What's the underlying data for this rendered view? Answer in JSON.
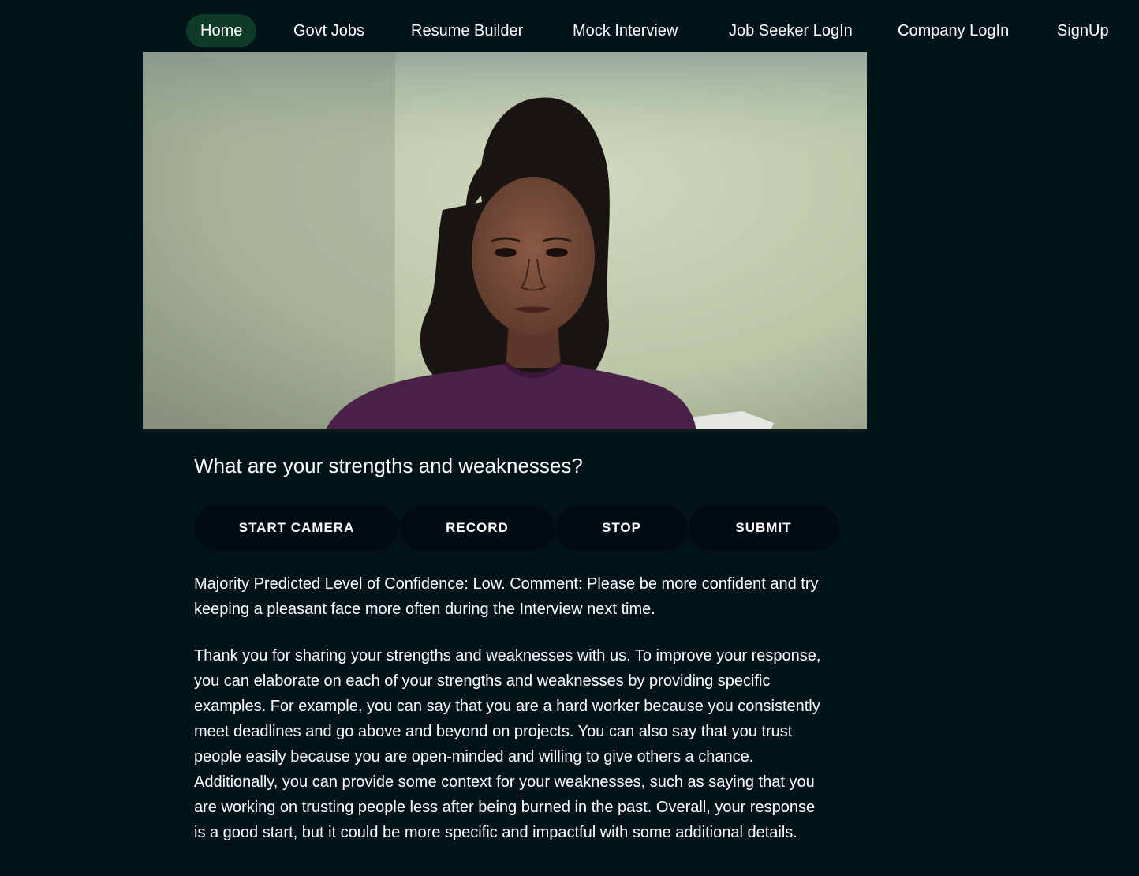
{
  "nav": {
    "items": [
      {
        "label": "Home",
        "active": true
      },
      {
        "label": "Govt Jobs"
      },
      {
        "label": "Resume Builder"
      },
      {
        "label": "Mock Interview"
      },
      {
        "label": "Job Seeker LogIn"
      },
      {
        "label": "Company LogIn"
      },
      {
        "label": "SignUp"
      }
    ]
  },
  "question": "What are your strengths and weaknesses?",
  "buttons": {
    "start_camera": "START CAMERA",
    "record": "RECORD",
    "stop": "STOP",
    "submit": "SUBMIT"
  },
  "feedback": {
    "confidence": "Majority Predicted Level of Confidence: Low. Comment: Please be more confident and try keeping a pleasant face more often during the Interview next time.",
    "response": "Thank you for sharing your strengths and weaknesses with us. To improve your response, you can elaborate on each of your strengths and weaknesses by providing specific examples. For example, you can say that you are a hard worker because you consistently meet deadlines and go above and beyond on projects. You can also say that you trust people easily because you are open-minded and willing to give others a chance. Additionally, you can provide some context for your weaknesses, such as saying that you are working on trusting people less after being burned in the past. Overall, your response is a good start, but it could be more specific and impactful with some additional details."
  },
  "colors": {
    "background": "#03131a",
    "nav_active": "#0e3a28",
    "button": "#010b14",
    "text": "#ffffff"
  }
}
